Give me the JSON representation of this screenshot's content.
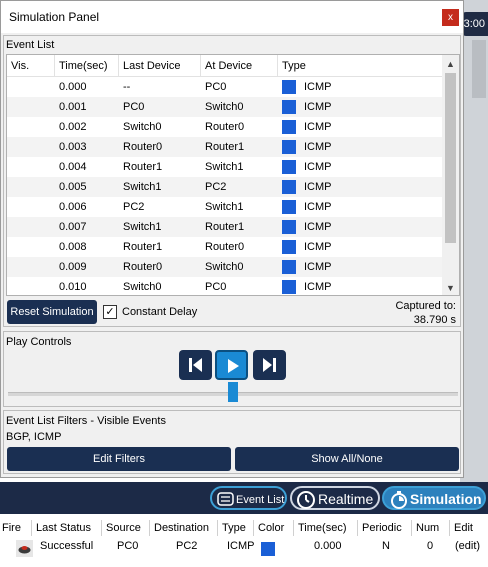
{
  "background": {
    "clock_text": "3:00"
  },
  "panel": {
    "title": "Simulation Panel",
    "close_label": "x"
  },
  "event_list": {
    "label": "Event List",
    "columns": [
      "Vis.",
      "Time(sec)",
      "Last Device",
      "At Device",
      "Type"
    ],
    "rows": [
      {
        "vis": "",
        "time": "0.000",
        "last": "--",
        "at": "PC0",
        "type": "ICMP",
        "color": "#1a5fd6"
      },
      {
        "vis": "",
        "time": "0.001",
        "last": "PC0",
        "at": "Switch0",
        "type": "ICMP",
        "color": "#1a5fd6"
      },
      {
        "vis": "",
        "time": "0.002",
        "last": "Switch0",
        "at": "Router0",
        "type": "ICMP",
        "color": "#1a5fd6"
      },
      {
        "vis": "",
        "time": "0.003",
        "last": "Router0",
        "at": "Router1",
        "type": "ICMP",
        "color": "#1a5fd6"
      },
      {
        "vis": "",
        "time": "0.004",
        "last": "Router1",
        "at": "Switch1",
        "type": "ICMP",
        "color": "#1a5fd6"
      },
      {
        "vis": "",
        "time": "0.005",
        "last": "Switch1",
        "at": "PC2",
        "type": "ICMP",
        "color": "#1a5fd6"
      },
      {
        "vis": "",
        "time": "0.006",
        "last": "PC2",
        "at": "Switch1",
        "type": "ICMP",
        "color": "#1a5fd6"
      },
      {
        "vis": "",
        "time": "0.007",
        "last": "Switch1",
        "at": "Router1",
        "type": "ICMP",
        "color": "#1a5fd6"
      },
      {
        "vis": "",
        "time": "0.008",
        "last": "Router1",
        "at": "Router0",
        "type": "ICMP",
        "color": "#1a5fd6"
      },
      {
        "vis": "",
        "time": "0.009",
        "last": "Router0",
        "at": "Switch0",
        "type": "ICMP",
        "color": "#1a5fd6"
      },
      {
        "vis": "",
        "time": "0.010",
        "last": "Switch0",
        "at": "PC0",
        "type": "ICMP",
        "color": "#1a5fd6"
      }
    ],
    "reset_label": "Reset Simulation",
    "constant_delay_label": "Constant Delay",
    "constant_delay_checked": true,
    "captured_label": "Captured to:",
    "captured_value": "38.790 s"
  },
  "play_controls": {
    "label": "Play Controls",
    "buttons": [
      "back-icon",
      "play-icon",
      "forward-icon"
    ],
    "slider_level": 0.5
  },
  "filters": {
    "label": "Event List Filters - Visible Events",
    "value": "BGP, ICMP",
    "edit_label": "Edit Filters",
    "show_label": "Show All/None"
  },
  "mode_bar": {
    "event_list_label": "Event List",
    "realtime_label": "Realtime",
    "simulation_label": "Simulation"
  },
  "pdu_table": {
    "columns": [
      "Fire",
      "Last Status",
      "Source",
      "Destination",
      "Type",
      "Color",
      "Time(sec)",
      "Periodic",
      "Num",
      "Edit"
    ],
    "rows": [
      {
        "last_status": "Successful",
        "source": "PC0",
        "destination": "PC2",
        "type": "ICMP",
        "color": "#1a5fd6",
        "time": "0.000",
        "periodic": "N",
        "num": "0",
        "edit": "(edit)"
      }
    ]
  },
  "colors": {
    "accent_dark": "#1a2f52",
    "accent_blue": "#1a8ad4",
    "icmp": "#1a5fd6",
    "close": "#c42b1c"
  }
}
